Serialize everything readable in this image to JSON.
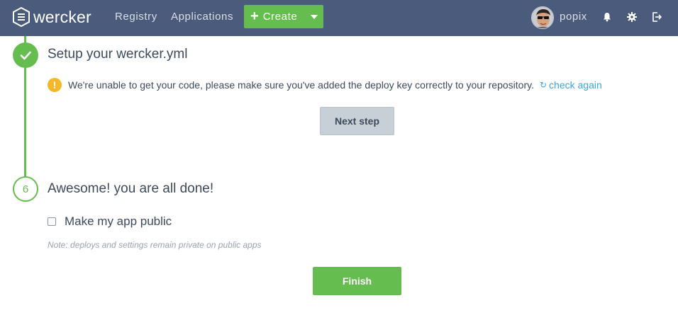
{
  "header": {
    "logo_text": "wercker",
    "nav": [
      {
        "label": "Registry"
      },
      {
        "label": "Applications"
      }
    ],
    "create_label": "Create",
    "username": "popix",
    "icons": [
      "bell-icon",
      "gear-icon",
      "logout-icon"
    ]
  },
  "steps": {
    "setup": {
      "title": "Setup your wercker.yml",
      "warning": "We're unable to get your code, please make sure you've added the deploy key correctly to your repository.",
      "check_again": "check again",
      "next_label": "Next step"
    },
    "done": {
      "number": "6",
      "title": "Awesome! you are all done!",
      "checkbox_label": "Make my app public",
      "checkbox_checked": false,
      "note": "Note: deploys and settings remain private on public apps",
      "finish_label": "Finish"
    }
  },
  "colors": {
    "topbar": "#4b5b7b",
    "accent_green": "#66bd4f",
    "link_blue": "#3aa7dd",
    "warning_yellow": "#f3b92a"
  }
}
